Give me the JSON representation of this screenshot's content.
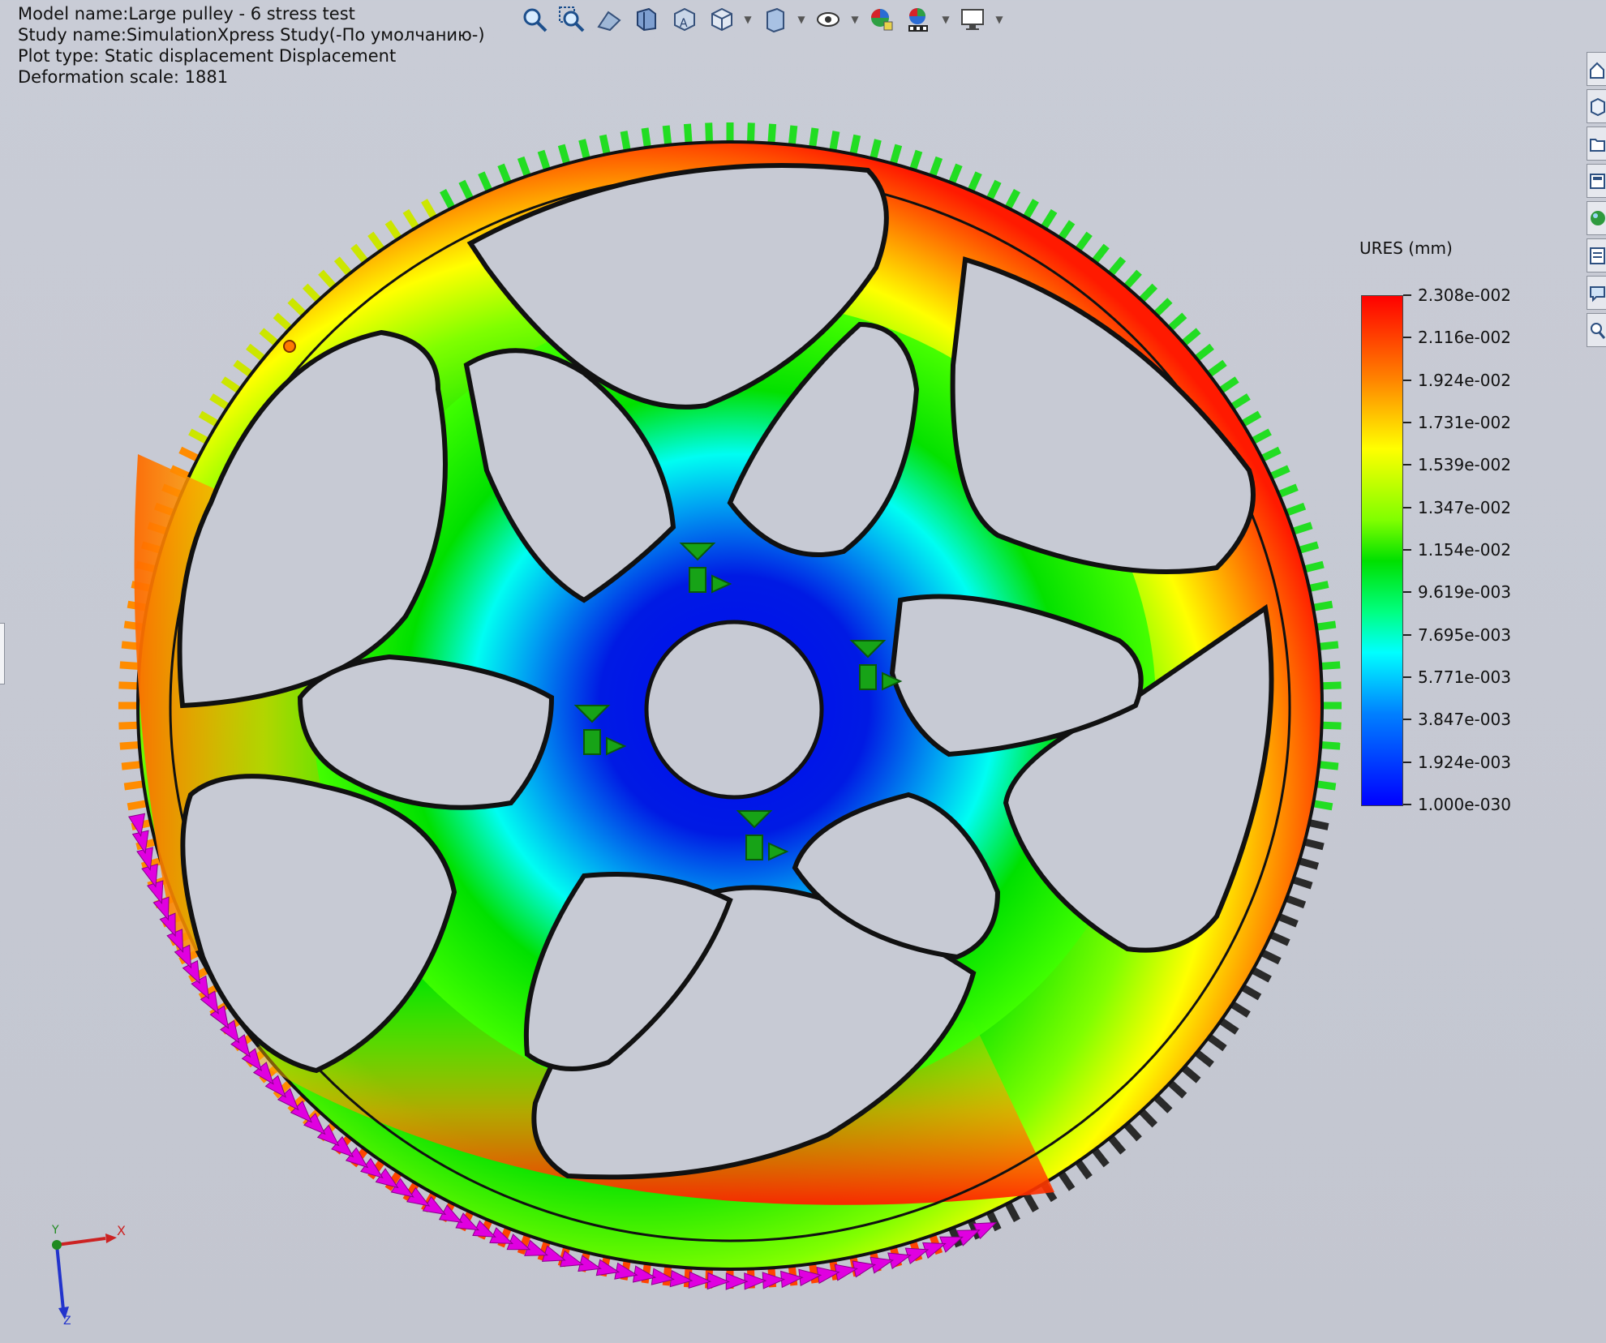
{
  "info": {
    "model_name": "Model name:Large pulley - 6 stress test",
    "study_name": "Study name:SimulationXpress Study(-По умолчанию-)",
    "plot_type": "Plot type: Static displacement Displacement",
    "deformation_scale": "Deformation scale: 1881"
  },
  "legend": {
    "title": "URES (mm)",
    "labels": [
      "2.308e-002",
      "2.116e-002",
      "1.924e-002",
      "1.731e-002",
      "1.539e-002",
      "1.347e-002",
      "1.154e-002",
      "9.619e-003",
      "7.695e-003",
      "5.771e-003",
      "3.847e-003",
      "1.924e-003",
      "1.000e-030"
    ],
    "colors": {
      "max": "#ff0000",
      "mid": "#00e000",
      "min": "#0000ff"
    }
  },
  "toolbar": {
    "icons": [
      "zoom-to-fit-icon",
      "zoom-to-area-icon",
      "previous-view-icon",
      "section-view-icon",
      "view-orientation-icon",
      "display-style-icon",
      "hide-show-items-icon",
      "edit-appearance-icon",
      "apply-scene-icon",
      "view-settings-icon",
      "plot-icon",
      "screen-icon"
    ]
  },
  "side_tools": {
    "icons": [
      "home-icon",
      "parts-icon",
      "folder-icon",
      "view-palette-icon",
      "appearances-icon",
      "custom-properties-icon",
      "forum-icon",
      "search-icon"
    ]
  },
  "triad": {
    "x_label": "X",
    "y_label": "Y",
    "z_label": "Z"
  }
}
